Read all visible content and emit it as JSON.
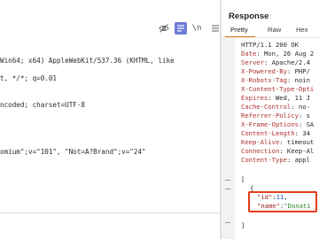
{
  "request": {
    "toolbar": {
      "eye_off_icon": "eye-off-icon",
      "wrap_icon": "wrap-lines-icon",
      "newline_label": "\\n",
      "menu_icon": "hamburger-menu-icon"
    },
    "lines": [
      "Win64; x64) AppleWebKit/537.36 (KHTML, like",
      "t, */*; q=0.01",
      "ncoded; charset=UTF-8",
      "omium\";v=\"101\", \"Not=A?Brand\";v=\"24\""
    ]
  },
  "response": {
    "title": "Response",
    "tabs": [
      "Pretty",
      "Raw",
      "Hex"
    ],
    "active_tab": "Pretty",
    "status_line": "HTTP/1.1 200 OK",
    "headers": [
      {
        "name": "Date",
        "value": ": Mon, 26 Aug 2"
      },
      {
        "name": "Server",
        "value": ": Apache/2.4"
      },
      {
        "name": "X-Powered-By",
        "value": ": PHP/"
      },
      {
        "name": "X-Robots-Tag",
        "value": ": noin"
      },
      {
        "name": "X-Content-Type-Opti",
        "value": ""
      },
      {
        "name": "Expires",
        "value": ": Wed, 11 J"
      },
      {
        "name": "Cache-Control",
        "value": ": no-"
      },
      {
        "name": "Referrer-Policy",
        "value": ": s"
      },
      {
        "name": "X-Frame-Options",
        "value": ": SA"
      },
      {
        "name": "Content-Length",
        "value": ": 34"
      },
      {
        "name": "Keep-Alive",
        "value": ": timeout"
      },
      {
        "name": "Connection",
        "value": ": Keep-Al"
      },
      {
        "name": "Content-Type",
        "value": ": appl"
      }
    ],
    "body": {
      "open_bracket": "[",
      "open_brace": "{",
      "id_key": "\"id\"",
      "id_colon": ":",
      "id_value": "11",
      "id_comma": ",",
      "name_key": "\"name\"",
      "name_colon": ":",
      "name_value": "\"Donati",
      "close_bracket": "]"
    },
    "highlight_color": "#e63b1a",
    "accent_color": "#e0761a"
  }
}
